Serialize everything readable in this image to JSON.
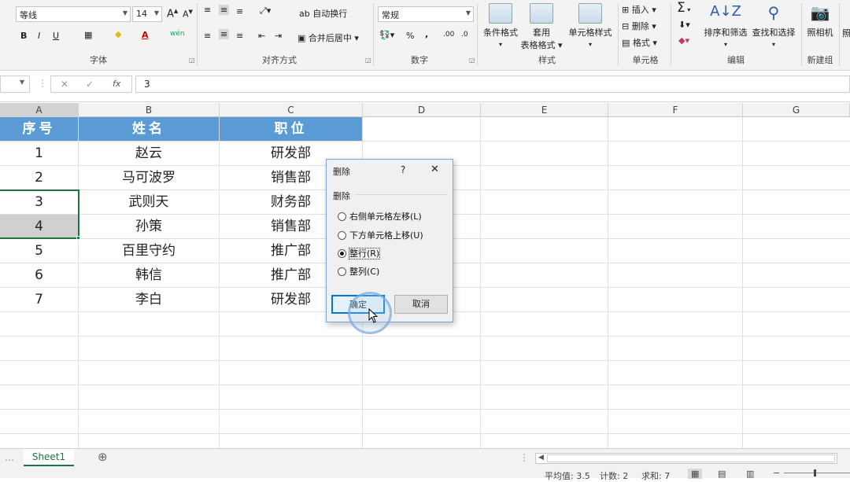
{
  "ribbon": {
    "font": {
      "name": "等线",
      "size": "14",
      "group_label": "字体",
      "grow": "A",
      "shrink": "A",
      "bold": "B",
      "italic": "I",
      "underline": "U",
      "font_color": "A",
      "phonetic": "wén"
    },
    "alignment": {
      "wrap_text": "自动换行",
      "merge_center": "合并后居中",
      "group_label": "对齐方式"
    },
    "number": {
      "format": "常规",
      "percent": "%",
      "comma": ",",
      "group_label": "数字"
    },
    "styles": {
      "conditional": "条件格式",
      "table_format_1": "套用",
      "table_format_2": "表格格式",
      "cell_styles": "单元格样式",
      "group_label": "样式"
    },
    "cells": {
      "insert": "插入",
      "delete": "删除",
      "format": "格式",
      "group_label": "单元格"
    },
    "editing": {
      "sigma": "Σ",
      "sort_filter": "排序和筛选",
      "find_select": "查找和选择",
      "group_label": "编辑"
    },
    "new_group": {
      "camera": "照相机",
      "group_label": "新建组"
    },
    "extra_label": "照"
  },
  "formula_bar": {
    "cancel": "✕",
    "enter": "✓",
    "fx": "fx",
    "value": "3"
  },
  "columns": [
    "A",
    "B",
    "C",
    "D",
    "E",
    "F",
    "G"
  ],
  "table": {
    "headers": [
      "序号",
      "姓名",
      "职位"
    ],
    "rows": [
      [
        "1",
        "赵云",
        "研发部"
      ],
      [
        "2",
        "马可波罗",
        "销售部"
      ],
      [
        "3",
        "武则天",
        "财务部"
      ],
      [
        "4",
        "孙策",
        "销售部"
      ],
      [
        "5",
        "百里守约",
        "推广部"
      ],
      [
        "6",
        "韩信",
        "推广部"
      ],
      [
        "7",
        "李白",
        "研发部"
      ]
    ]
  },
  "dialog": {
    "title": "删除",
    "help": "?",
    "close": "✕",
    "group_label": "删除",
    "options": [
      "右侧单元格左移(L)",
      "下方单元格上移(U)",
      "整行(R)",
      "整列(C)"
    ],
    "selected_index": 2,
    "ok": "确定",
    "cancel": "取消"
  },
  "sheet_tab": "Sheet1",
  "add_sheet": "⊕",
  "status": {
    "average": "平均值: 3.5",
    "count": "计数: 2",
    "sum": "求和: 7"
  },
  "colors": {
    "header_fill": "#5b9bd5",
    "selection": "#217346",
    "accent": "#7aa7d8"
  }
}
